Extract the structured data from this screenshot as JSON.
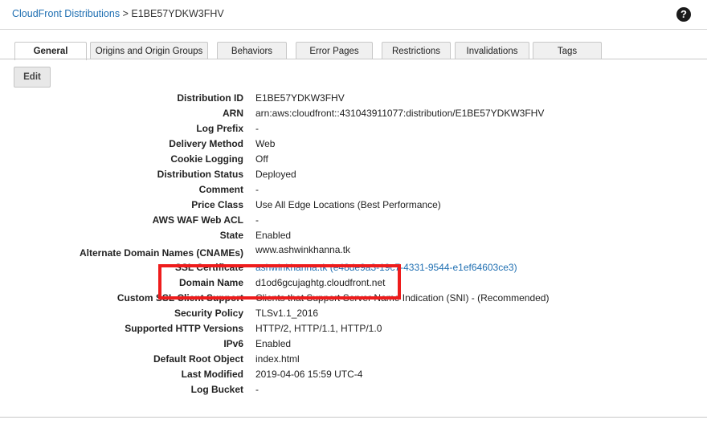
{
  "breadcrumb": {
    "parent": "CloudFront Distributions",
    "separator": ">",
    "current": "E1BE57YDKW3FHV"
  },
  "help_icon": "?",
  "tabs": [
    {
      "label": "General",
      "active": true
    },
    {
      "label": "Origins and Origin Groups",
      "active": false
    },
    {
      "label": "Behaviors",
      "active": false
    },
    {
      "label": "Error Pages",
      "active": false
    },
    {
      "label": "Restrictions",
      "active": false
    },
    {
      "label": "Invalidations",
      "active": false
    },
    {
      "label": "Tags",
      "active": false
    }
  ],
  "edit_label": "Edit",
  "details": [
    {
      "label": "Distribution ID",
      "value": "E1BE57YDKW3FHV"
    },
    {
      "label": "ARN",
      "value": "arn:aws:cloudfront::431043911077:distribution/E1BE57YDKW3FHV"
    },
    {
      "label": "Log Prefix",
      "value": "-"
    },
    {
      "label": "Delivery Method",
      "value": "Web"
    },
    {
      "label": "Cookie Logging",
      "value": "Off"
    },
    {
      "label": "Distribution Status",
      "value": "Deployed"
    },
    {
      "label": "Comment",
      "value": "-"
    },
    {
      "label": "Price Class",
      "value": "Use All Edge Locations (Best Performance)"
    },
    {
      "label": "AWS WAF Web ACL",
      "value": "-"
    },
    {
      "label": "State",
      "value": "Enabled"
    },
    {
      "label": "Alternate Domain Names (CNAMEs)",
      "value": "www.ashwinkhanna.tk"
    },
    {
      "label": "SSL Certificate",
      "value": "ashwinkhanna.tk (e48de9a3-19c7-4331-9544-e1ef64603ce3)"
    },
    {
      "label": "Domain Name",
      "value": "d1od6gcujaghtg.cloudfront.net"
    },
    {
      "label": "Custom SSL Client Support",
      "value": "Clients that Support Server Name Indication (SNI) - (Recommended)"
    },
    {
      "label": "Security Policy",
      "value": "TLSv1.1_2016"
    },
    {
      "label": "Supported HTTP Versions",
      "value": "HTTP/2, HTTP/1.1, HTTP/1.0"
    },
    {
      "label": "IPv6",
      "value": "Enabled"
    },
    {
      "label": "Default Root Object",
      "value": "index.html"
    },
    {
      "label": "Last Modified",
      "value": "2019-04-06 15:59 UTC-4"
    },
    {
      "label": "Log Bucket",
      "value": "-"
    }
  ],
  "colors": {
    "link": "#1f6fb2",
    "highlight": "#ee1c1c"
  }
}
